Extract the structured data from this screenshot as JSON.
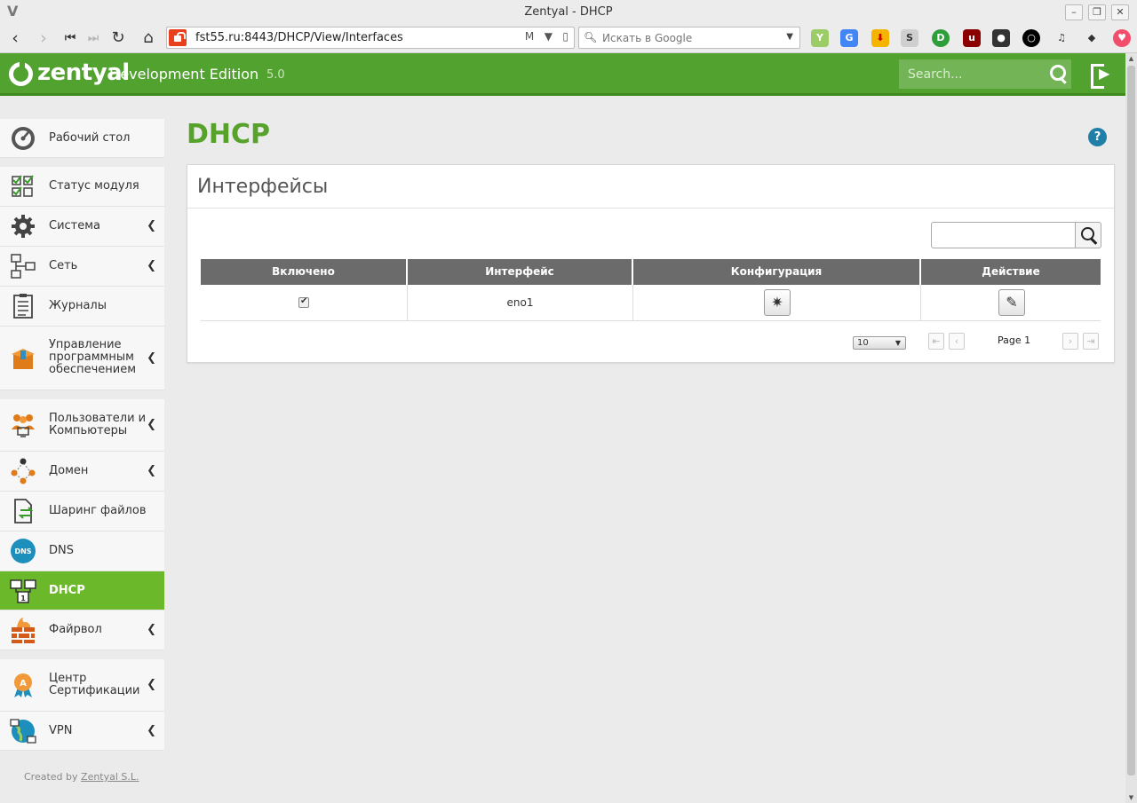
{
  "browser": {
    "window_title": "Zentyal - DHCP",
    "url": "fst55.ru:8443/DHCP/View/Interfaces",
    "search_placeholder": "Искать в Google"
  },
  "header": {
    "brand": "zentyal",
    "edition": "Development Edition",
    "version": "5.0",
    "search_placeholder": "Search..."
  },
  "sidebar": {
    "items": [
      {
        "label": "Рабочий стол",
        "icon": "dashboard-icon",
        "active": false,
        "chevron": false
      },
      {
        "label": "Статус модуля",
        "icon": "module-status-icon",
        "active": false,
        "chevron": false
      },
      {
        "label": "Система",
        "icon": "gear-icon",
        "active": false,
        "chevron": true
      },
      {
        "label": "Сеть",
        "icon": "network-icon",
        "active": false,
        "chevron": true
      },
      {
        "label": "Журналы",
        "icon": "logs-icon",
        "active": false,
        "chevron": false
      },
      {
        "label": "Управление программным обеспечением",
        "icon": "software-box-icon",
        "active": false,
        "chevron": true
      },
      {
        "label": "Пользователи и Компьютеры",
        "icon": "users-computers-icon",
        "active": false,
        "chevron": true
      },
      {
        "label": "Домен",
        "icon": "domain-icon",
        "active": false,
        "chevron": true
      },
      {
        "label": "Шаринг файлов",
        "icon": "file-sharing-icon",
        "active": false,
        "chevron": false
      },
      {
        "label": "DNS",
        "icon": "dns-icon",
        "active": false,
        "chevron": false
      },
      {
        "label": "DHCP",
        "icon": "dhcp-icon",
        "active": true,
        "chevron": false
      },
      {
        "label": "Файрвол",
        "icon": "firewall-icon",
        "active": false,
        "chevron": true
      },
      {
        "label": "Центр Сертификации",
        "icon": "certificate-icon",
        "active": false,
        "chevron": true
      },
      {
        "label": "VPN",
        "icon": "vpn-icon",
        "active": false,
        "chevron": true
      }
    ],
    "credit_prefix": "Created by",
    "credit_link": "Zentyal S.L."
  },
  "main": {
    "page_title": "DHCP",
    "panel_title": "Интерфейсы",
    "table": {
      "columns": [
        "Включено",
        "Интерфейс",
        "Конфигурация",
        "Действие"
      ],
      "rows": [
        {
          "enabled": true,
          "interface": "eno1"
        }
      ]
    },
    "pager": {
      "page_size": "10",
      "page_label": "Page 1"
    }
  },
  "colors": {
    "brand_green": "#52a22f",
    "active_green": "#6bb92b",
    "title_green": "#56a22a",
    "table_header": "#6b6b6b"
  }
}
